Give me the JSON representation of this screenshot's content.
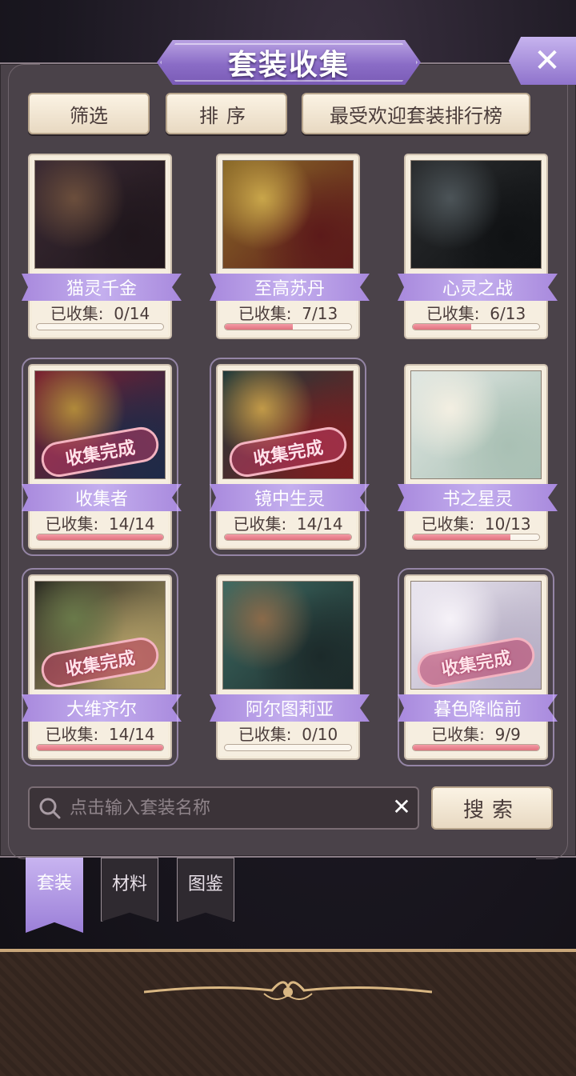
{
  "header": {
    "title": "套装收集"
  },
  "toolbar": {
    "filter_label": "筛选",
    "sort_label": "排序",
    "ranking_label": "最受欢迎套装排行榜"
  },
  "stamp_label": "收集完成",
  "suits": [
    {
      "name": "猫灵千金",
      "count": "已收集:  0/14",
      "progress": 0.0,
      "complete": false
    },
    {
      "name": "至高苏丹",
      "count": "已收集:  7/13",
      "progress": 0.54,
      "complete": false
    },
    {
      "name": "心灵之战",
      "count": "已收集:  6/13",
      "progress": 0.46,
      "complete": false
    },
    {
      "name": "收集者",
      "count": "已收集:  14/14",
      "progress": 1.0,
      "complete": true
    },
    {
      "name": "镜中生灵",
      "count": "已收集:  14/14",
      "progress": 1.0,
      "complete": true
    },
    {
      "name": "书之星灵",
      "count": "已收集:  10/13",
      "progress": 0.77,
      "complete": false
    },
    {
      "name": "大维齐尔",
      "count": "已收集:  14/14",
      "progress": 1.0,
      "complete": true
    },
    {
      "name": "阿尔图莉亚",
      "count": "已收集:  0/10",
      "progress": 0.0,
      "complete": false
    },
    {
      "name": "暮色降临前",
      "count": "已收集:  9/9",
      "progress": 1.0,
      "complete": true
    }
  ],
  "search": {
    "placeholder": "点击输入套装名称",
    "button_label": "搜索"
  },
  "tabs": [
    {
      "label": "套装",
      "active": true
    },
    {
      "label": "材料",
      "active": false
    },
    {
      "label": "图鉴",
      "active": false
    }
  ],
  "colors": {
    "accent_purple": "#9b7fd8",
    "progress_pink": "#e0737f",
    "panel_bg": "#4a4249",
    "card_bg": "#f6eee0"
  },
  "icons": {
    "close": "close-icon",
    "search": "search-icon",
    "clear": "clear-icon"
  }
}
